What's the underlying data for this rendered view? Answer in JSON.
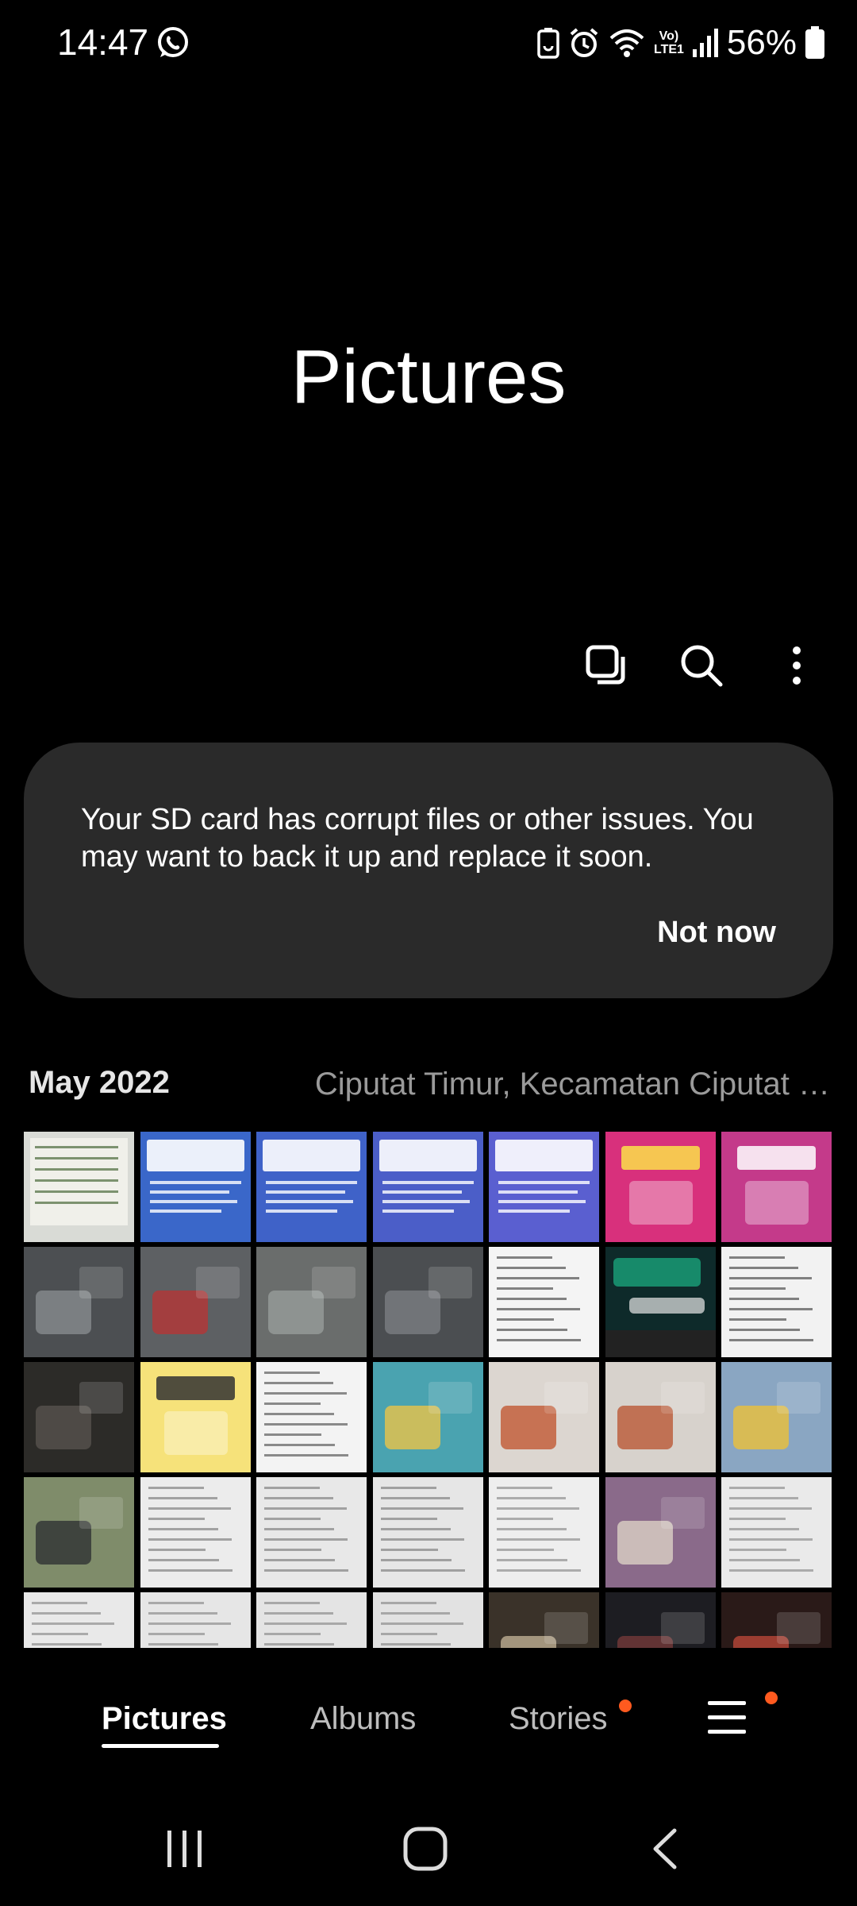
{
  "status_bar": {
    "time": "14:47",
    "network": "Vo) LTE1",
    "network_top": "Vo)",
    "network_bottom": "LTE1",
    "battery": "56%"
  },
  "header": {
    "title": "Pictures"
  },
  "toolbar": {
    "icons": [
      "select-icon",
      "search-icon",
      "more-options-icon"
    ]
  },
  "notice": {
    "message": "Your SD card has corrupt files or other issues. You may want to back it up and replace it soon.",
    "dismiss_label": "Not now"
  },
  "section": {
    "date": "May 2022",
    "location": "Ciputat Timur, Kecamatan Ciputat …"
  },
  "thumbnails": [
    {
      "bg": "#d9dbd6",
      "fg": "#4a6a3a",
      "kind": "board"
    },
    {
      "bg": "#3a67c9",
      "fg": "#ffffff",
      "kind": "slide"
    },
    {
      "bg": "#3f62c8",
      "fg": "#ffffff",
      "kind": "slide"
    },
    {
      "bg": "#4b5ec8",
      "fg": "#ffffff",
      "kind": "slide"
    },
    {
      "bg": "#5a5fd0",
      "fg": "#ffffff",
      "kind": "slide"
    },
    {
      "bg": "#d8307c",
      "fg": "#fbe04a",
      "kind": "poster"
    },
    {
      "bg": "#c43a8a",
      "fg": "#ffffff",
      "kind": "poster"
    },
    {
      "bg": "#4c4f52",
      "fg": "#8b8f93",
      "kind": "photo"
    },
    {
      "bg": "#5d6063",
      "fg": "#b33",
      "kind": "photo"
    },
    {
      "bg": "#6a6d6c",
      "fg": "#9ba09e",
      "kind": "photo"
    },
    {
      "bg": "#4b4e51",
      "fg": "#7d8185",
      "kind": "photo"
    },
    {
      "bg": "#f4f4f4",
      "fg": "#222222",
      "kind": "text"
    },
    {
      "bg": "#0e2a2a",
      "fg": "#1aa37a",
      "kind": "chat"
    },
    {
      "bg": "#f2f2f2",
      "fg": "#222222",
      "kind": "text"
    },
    {
      "bg": "#2c2b28",
      "fg": "#5a5650",
      "kind": "photo"
    },
    {
      "bg": "#f6e27a",
      "fg": "#333333",
      "kind": "poster"
    },
    {
      "bg": "#f3f3f3",
      "fg": "#333333",
      "kind": "text"
    },
    {
      "bg": "#4aa3b0",
      "fg": "#f5c542",
      "kind": "photo"
    },
    {
      "bg": "#dcd6d0",
      "fg": "#c0502a",
      "kind": "photo"
    },
    {
      "bg": "#d7d2cc",
      "fg": "#b8502c",
      "kind": "photo"
    },
    {
      "bg": "#8aa6c2",
      "fg": "#f2c230",
      "kind": "photo"
    },
    {
      "bg": "#7f8c6a",
      "fg": "#2a2c30",
      "kind": "photo"
    },
    {
      "bg": "#ececec",
      "fg": "#666666",
      "kind": "paper"
    },
    {
      "bg": "#e8e8e8",
      "fg": "#666666",
      "kind": "paper"
    },
    {
      "bg": "#e6e6e6",
      "fg": "#666666",
      "kind": "paper"
    },
    {
      "bg": "#eeeeee",
      "fg": "#777777",
      "kind": "paper"
    },
    {
      "bg": "#8a6a8a",
      "fg": "#e0d8c8",
      "kind": "photo"
    },
    {
      "bg": "#eaeaea",
      "fg": "#777777",
      "kind": "paper"
    },
    {
      "bg": "#e9e9e9",
      "fg": "#777777",
      "kind": "paper"
    },
    {
      "bg": "#e6e6e6",
      "fg": "#777777",
      "kind": "paper"
    },
    {
      "bg": "#e4e4e4",
      "fg": "#777777",
      "kind": "paper"
    },
    {
      "bg": "#e2e2e2",
      "fg": "#777777",
      "kind": "paper"
    },
    {
      "bg": "#3a3229",
      "fg": "#c7b79a",
      "kind": "photo"
    },
    {
      "bg": "#1d1d22",
      "fg": "#7a3b3b",
      "kind": "photo"
    },
    {
      "bg": "#2a1a18",
      "fg": "#c24a3a",
      "kind": "photo"
    }
  ],
  "bottom_nav": {
    "tabs": [
      {
        "label": "Pictures",
        "active": true
      },
      {
        "label": "Albums",
        "active": false
      },
      {
        "label": "Stories",
        "active": false
      }
    ],
    "menu_icon": "menu-icon"
  },
  "colors": {
    "accent_dot": "#ff5a1f",
    "card_bg": "#2a2a2a"
  },
  "system_nav": {
    "icons": [
      "recents-icon",
      "home-icon",
      "back-icon"
    ]
  }
}
